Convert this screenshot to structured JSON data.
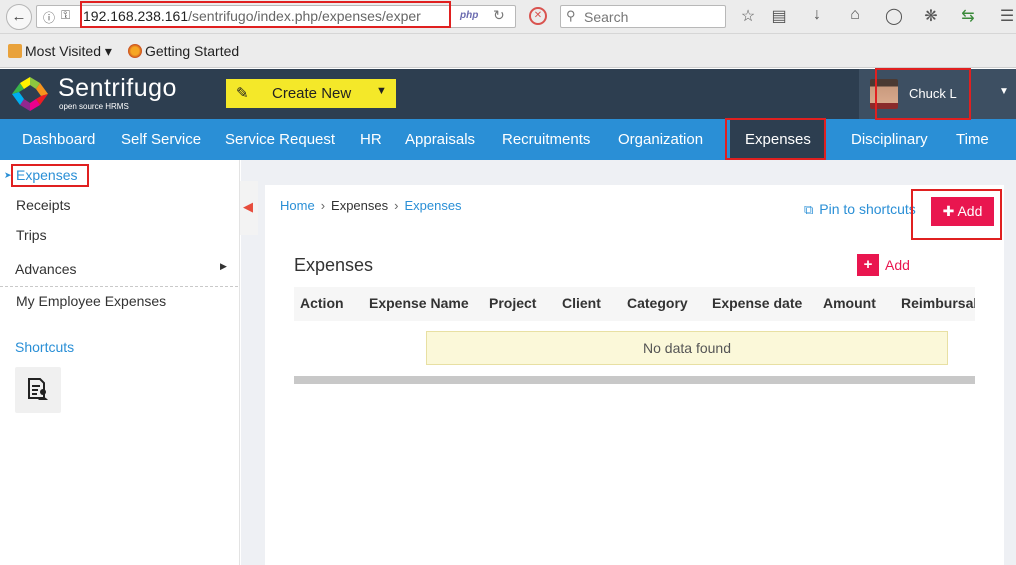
{
  "browser": {
    "url_host": "192.168.238.161",
    "url_path": "/sentrifugo/index.php/expenses/exper",
    "url_badge": "php",
    "search_placeholder": "Search",
    "bookmarks": [
      {
        "label": "Most Visited"
      },
      {
        "label": "Getting Started"
      }
    ]
  },
  "header": {
    "logo_title": "Sentrifugo",
    "logo_subtitle": "open source HRMS",
    "create_new_label": "Create New",
    "user_name": "Chuck L"
  },
  "nav": {
    "items": [
      {
        "label": "Dashboard"
      },
      {
        "label": "Self Service"
      },
      {
        "label": "Service Request"
      },
      {
        "label": "HR"
      },
      {
        "label": "Appraisals"
      },
      {
        "label": "Recruitments"
      },
      {
        "label": "Organization"
      },
      {
        "label": "Expenses"
      },
      {
        "label": "Disciplinary"
      },
      {
        "label": "Time"
      }
    ],
    "active": "Expenses"
  },
  "sidebar": {
    "items": [
      {
        "label": "Expenses"
      },
      {
        "label": "Receipts"
      },
      {
        "label": "Trips"
      },
      {
        "label": "Advances"
      },
      {
        "label": "My Employee Expenses"
      }
    ],
    "shortcuts_label": "Shortcuts"
  },
  "breadcrumb": {
    "home": "Home",
    "parent": "Expenses",
    "current": "Expenses"
  },
  "actions": {
    "pin_label": "Pin to shortcuts",
    "add_label": "Add"
  },
  "section": {
    "title": "Expenses",
    "add_label": "Add"
  },
  "table": {
    "columns": [
      "Action",
      "Expense Name",
      "Project",
      "Client",
      "Category",
      "Expense date",
      "Amount",
      "Reimbursab"
    ],
    "empty_message": "No data found"
  },
  "colors": {
    "nav_blue": "#2a8fd6",
    "header_dark": "#2d3e50",
    "create_yellow": "#f4e829",
    "add_pink": "#e9164f",
    "highlight_red": "#e02020"
  }
}
